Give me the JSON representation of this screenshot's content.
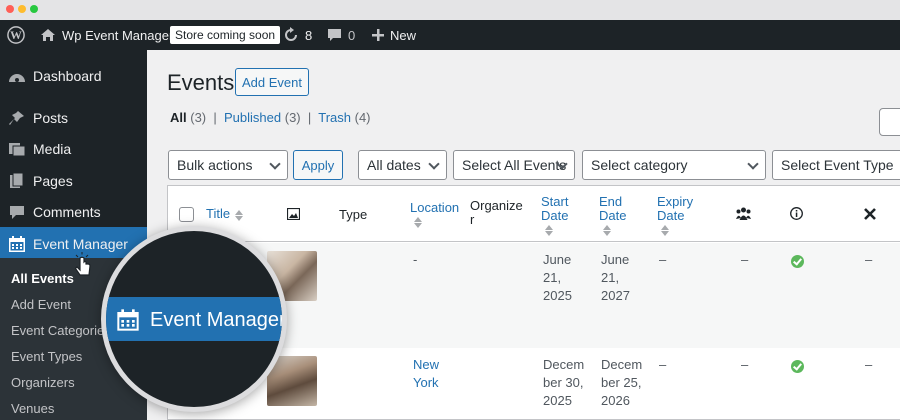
{
  "adminbar": {
    "site_name": "Wp Event Manager",
    "store_badge": "Store coming soon",
    "updates_count": "8",
    "comments_count": "0",
    "new_label": "New"
  },
  "sidebar": {
    "items": [
      {
        "label": "Dashboard",
        "icon": "dashboard-icon"
      },
      {
        "label": "Posts",
        "icon": "pin-icon"
      },
      {
        "label": "Media",
        "icon": "media-icon"
      },
      {
        "label": "Pages",
        "icon": "pages-icon"
      },
      {
        "label": "Comments",
        "icon": "comment-icon"
      },
      {
        "label": "Event Manager",
        "icon": "calendar-icon",
        "active": true
      }
    ],
    "submenu": [
      "All Events",
      "Add Event",
      "Event Categories",
      "Event Types",
      "Organizers",
      "Venues"
    ]
  },
  "main": {
    "title": "Events",
    "add_button": "Add Event",
    "filters": {
      "all_label": "All",
      "all_count": "(3)",
      "published_label": "Published",
      "published_count": "(3)",
      "trash_label": "Trash",
      "trash_count": "(4)"
    },
    "toolbar": {
      "bulk_actions": "Bulk actions",
      "apply": "Apply",
      "dates": "All dates",
      "events": "Select All Events",
      "category": "Select category",
      "event_type": "Select Event Type"
    },
    "columns": {
      "title": "Title",
      "type": "Type",
      "location": "Location",
      "organizer": "Organize r",
      "start_date": "Start Date",
      "end_date": "End Date",
      "expiry_date": "Expiry Date"
    },
    "rows": [
      {
        "location": "-",
        "start": [
          "June",
          "21,",
          "2025"
        ],
        "end": [
          "June",
          "21,",
          "2027"
        ],
        "expiry": "–",
        "attendees": "–",
        "status": "active",
        "extra": "–"
      },
      {
        "location": "New York",
        "start": [
          "Decem",
          "ber 30,",
          "2025"
        ],
        "end": [
          "Decem",
          "ber 25,",
          "2026"
        ],
        "expiry": "–",
        "attendees": "–",
        "status": "active",
        "extra": "–"
      }
    ]
  },
  "magnifier": {
    "label": "Event Manager"
  },
  "colors": {
    "admin_dark": "#1d2327",
    "accent": "#2271b1",
    "success": "#5cb85c"
  }
}
